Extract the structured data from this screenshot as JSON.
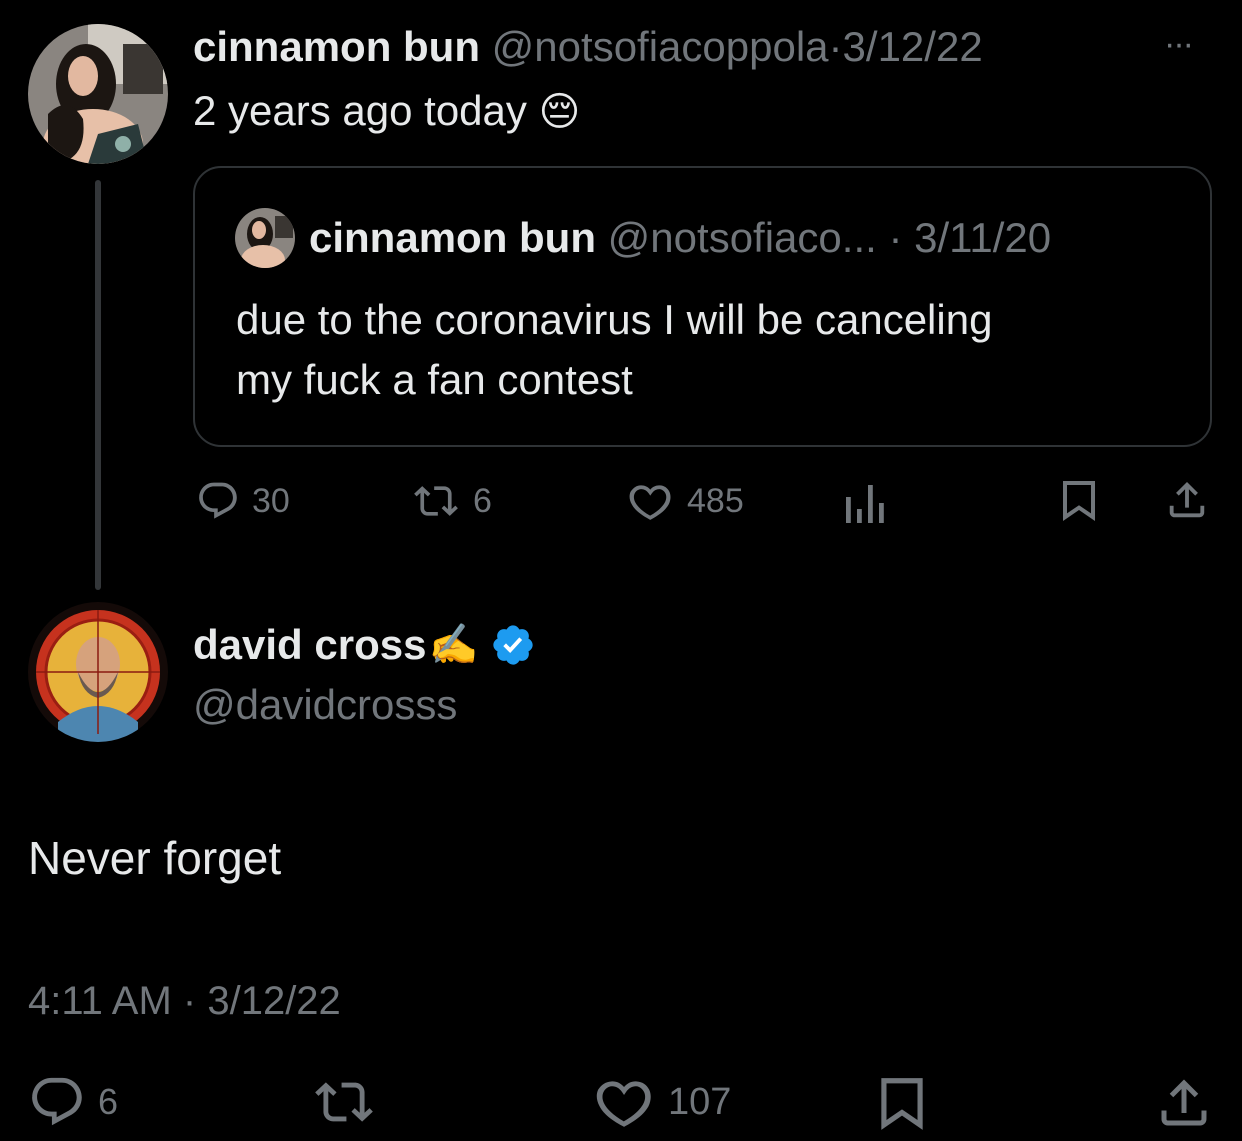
{
  "main_tweet": {
    "display_name": "cinnamon bun",
    "handle": "@notsofiacoppola",
    "separator": "·",
    "date": "3/12/22",
    "more_label": "···",
    "text": "2 years ago today",
    "emoji": "😔",
    "stats": {
      "replies": "30",
      "retweets": "6",
      "likes": "485"
    }
  },
  "quoted_tweet": {
    "display_name": "cinnamon bun",
    "handle": "@notsofiaco...",
    "separator": "·",
    "date": "3/11/20",
    "text_line1": "due to the coronavirus I will be canceling",
    "text_line2": "my fuck a fan contest"
  },
  "reply_tweet": {
    "display_name": "david cross",
    "name_emoji": "✍️",
    "verified": true,
    "handle": "@davidcrosss",
    "text": "Never forget",
    "timestamp": "4:11 AM · 3/12/22",
    "stats": {
      "replies": "6",
      "likes": "107"
    }
  },
  "colors": {
    "background": "#000000",
    "text": "#e7e9ea",
    "muted": "#71767b",
    "verified_blue": "#1d9bf0",
    "border": "#2f3336"
  },
  "icons": [
    "reply-icon",
    "retweet-icon",
    "like-icon",
    "views-icon",
    "bookmark-icon",
    "share-icon",
    "verified-icon",
    "more-icon"
  ]
}
